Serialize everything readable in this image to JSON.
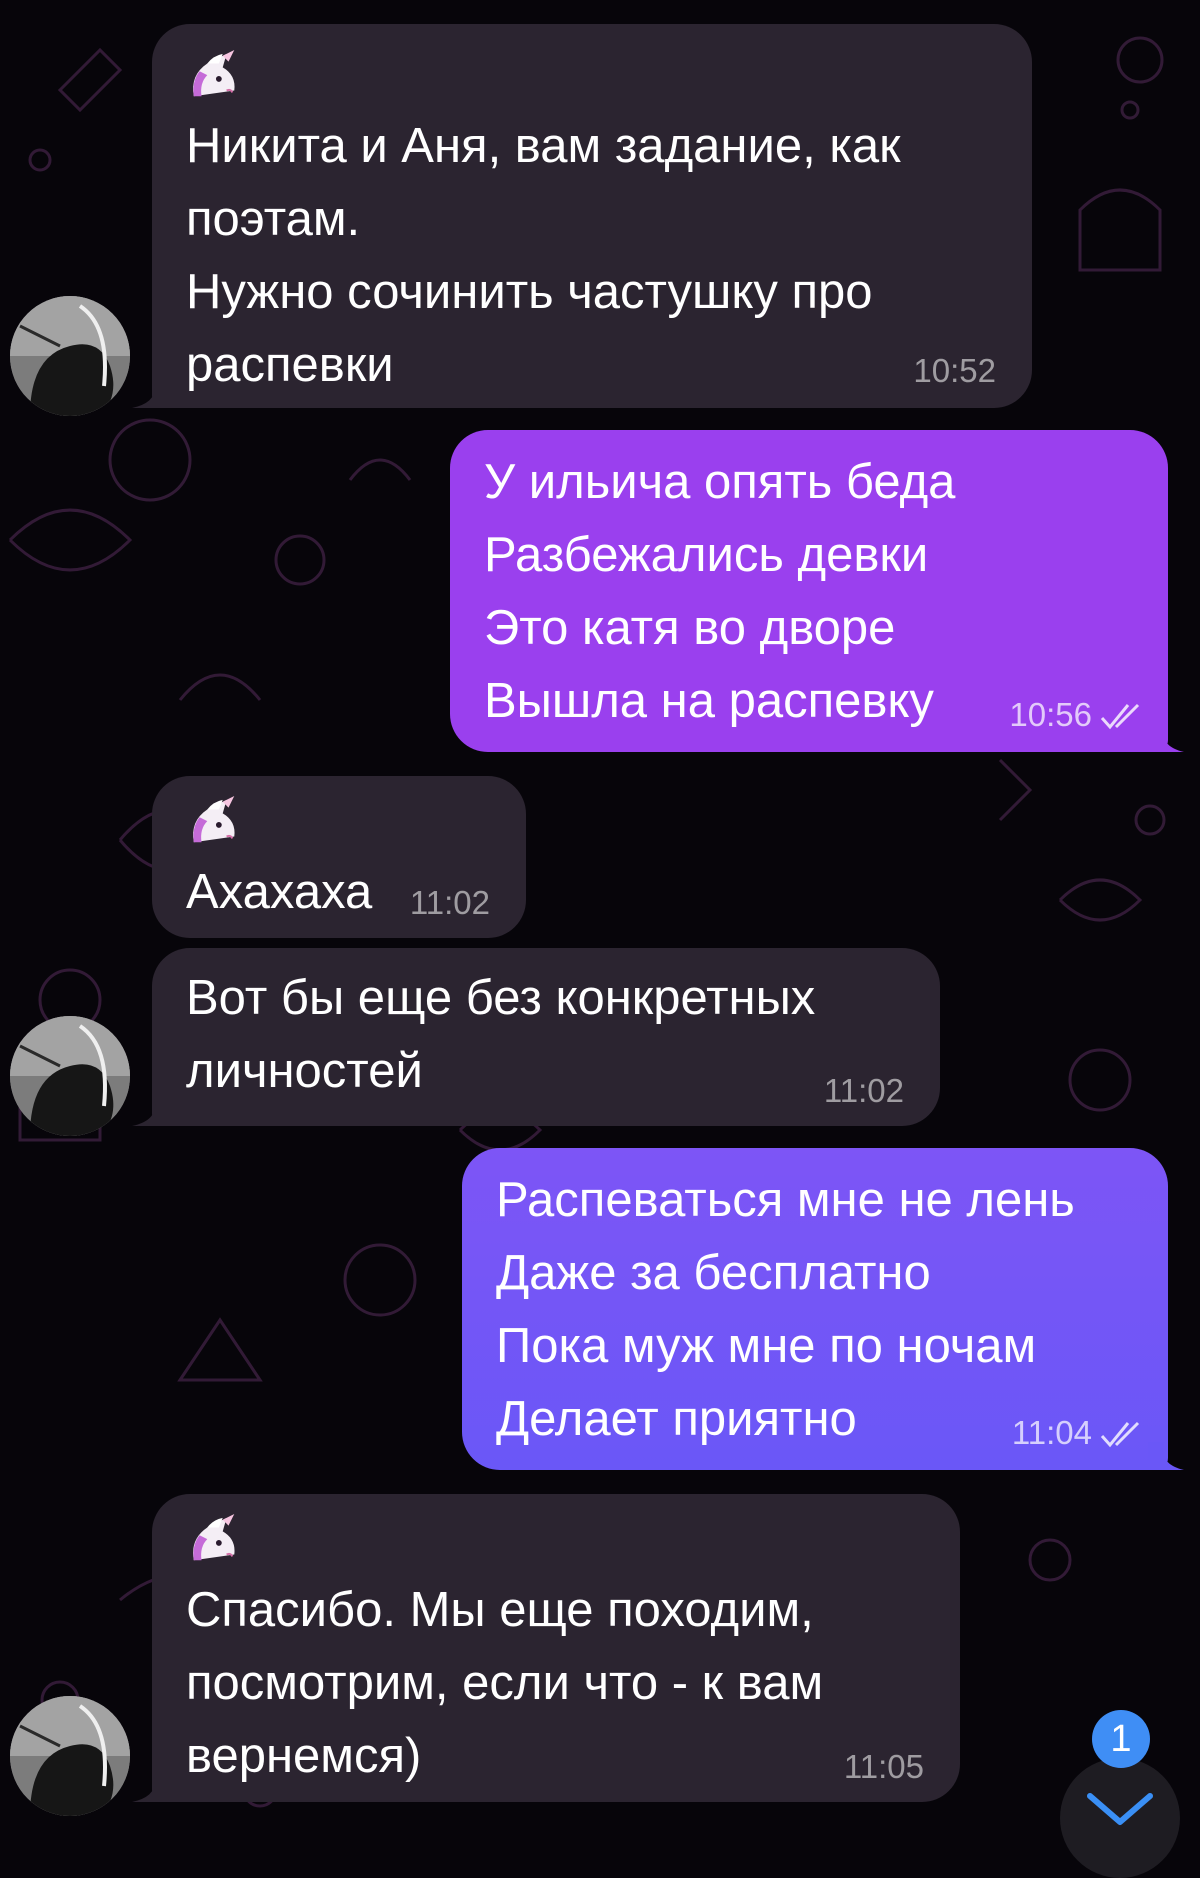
{
  "messages": [
    {
      "sender": "other",
      "text": "Никита и Аня, вам задание, как\nпоэтам.\nНужно сочинить частушку про\nраспевки",
      "time": "10:52",
      "emoji": "unicorn-icon"
    },
    {
      "sender": "me",
      "text": "У ильича опять беда\nРазбежались девки\nЭто катя во дворе\nВышла на распевку",
      "time": "10:56",
      "status": "read"
    },
    {
      "sender": "other",
      "text": "Ахахаха",
      "time": "11:02",
      "emoji": "unicorn-icon"
    },
    {
      "sender": "other",
      "text": "Вот бы еще без конкретных\nличностей",
      "time": "11:02"
    },
    {
      "sender": "me",
      "text": "Распеваться мне не лень\nДаже за бесплатно\nПока муж мне по ночам\nДелает приятно",
      "time": "11:04",
      "status": "read"
    },
    {
      "sender": "other",
      "text": "Спасибо. Мы еще походим,\nпосмотрим, если что - к вам\nвернемся)",
      "time": "11:05",
      "emoji": "unicorn-icon"
    }
  ],
  "unread_badge": "1",
  "colors": {
    "background": "#07050a",
    "incoming_bubble": "#2b2430",
    "outgoing_bubble_1": "#9a40ee",
    "outgoing_bubble_2": "#6a57f7",
    "badge": "#3f8ef5",
    "accent": "#3a8ff5"
  }
}
